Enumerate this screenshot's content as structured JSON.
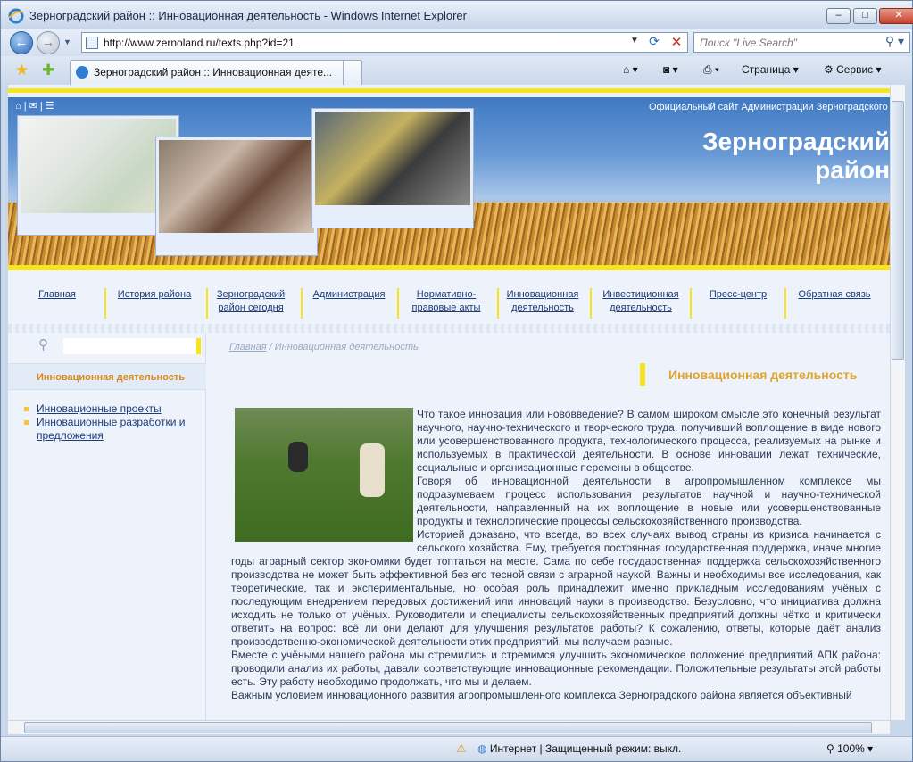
{
  "window": {
    "title": "Зерноградский район :: Инновационная деятельность - Windows Internet Explorer"
  },
  "address": {
    "url": "http://www.zernoland.ru/texts.php?id=21"
  },
  "search": {
    "placeholder": "Поиск \"Live Search\""
  },
  "tab": {
    "label": "Зерноградский район :: Инновационная деяте..."
  },
  "toolbar": {
    "page_label": "Страница",
    "service_label": "Сервис"
  },
  "site": {
    "official": "Официальный сайт Администрации Зерноградского района Ростовской области",
    "name_line1": "Зерноградский",
    "name_line2": "район"
  },
  "menu": [
    {
      "label": "Главная"
    },
    {
      "label": "История района"
    },
    {
      "label": "Зерноградский район сегодня"
    },
    {
      "label": "Администрация"
    },
    {
      "label": "Нормативно-правовые акты"
    },
    {
      "label": "Инновационная деятельность"
    },
    {
      "label": "Инвестиционная деятельность"
    },
    {
      "label": "Пресс-центр"
    },
    {
      "label": "Обратная связь"
    }
  ],
  "sidebar": {
    "title": "Инновационная деятельность",
    "links": [
      {
        "label": "Инновационные проекты"
      },
      {
        "label": "Инновационные разработки и предложения"
      }
    ]
  },
  "breadcrumb": {
    "home": "Главная",
    "sep": " / ",
    "current": "Инновационная деятельность"
  },
  "heading": "Инновационная деятельность",
  "article": [
    "Что такое инновация или нововведение? В самом широком смысле это конечный результат научного, научно-технического и творческого труда, получивший воплощение в виде нового или усовершенствованного продукта, технологического процесса, реализуемых на рынке и используемых в практической деятельности. В основе инновации лежат технические, социальные и организационные перемены в обществе.",
    "Говоря об инновационной деятельности в агропромышленном комплексе мы подразумеваем процесс использования результатов научной и научно-технической деятельности, направленный на их воплощение в новые или усовершенствованные продукты и технологические процессы сельскохозяйственного производства.",
    "Историей доказано, что всегда, во всех случаях вывод страны из кризиса начинается с сельского хозяйства. Ему, требуется постоянная государственная поддержка, иначе многие годы аграрный сектор экономики будет топтаться на месте. Сама по себе государственная поддержка сельскохозяйственного производства не может быть эффективной без его тесной связи с аграрной наукой. Важны и необходимы все исследования, как теоретические, так и экспериментальные, но особая роль принадлежит именно прикладным исследованиям учёных с последующим внедрением передовых достижений или инноваций науки в производство. Безусловно, что инициатива должна исходить не только от учёных. Руководители и специалисты сельскохозяйственных предприятий должны чётко и критически ответить на вопрос: всё ли они делают для улучшения результатов работы? К сожалению, ответы, которые даёт анализ производственно-экономической деятельности этих предприятий, мы получаем разные.",
    "Вместе с учёными нашего района мы стремились и стремимся улучшить экономическое положение предприятий АПК района: проводили анализ их работы, давали соответствующие инновационные рекомендации. Положительные результаты этой работы есть. Эту работу необходимо продолжать, что мы и делаем.",
    "Важным условием инновационного развития агропромышленного комплекса Зерноградского района является объективный"
  ],
  "status": {
    "zone": "Интернет | Защищенный режим: выкл.",
    "zoom": "100%"
  }
}
